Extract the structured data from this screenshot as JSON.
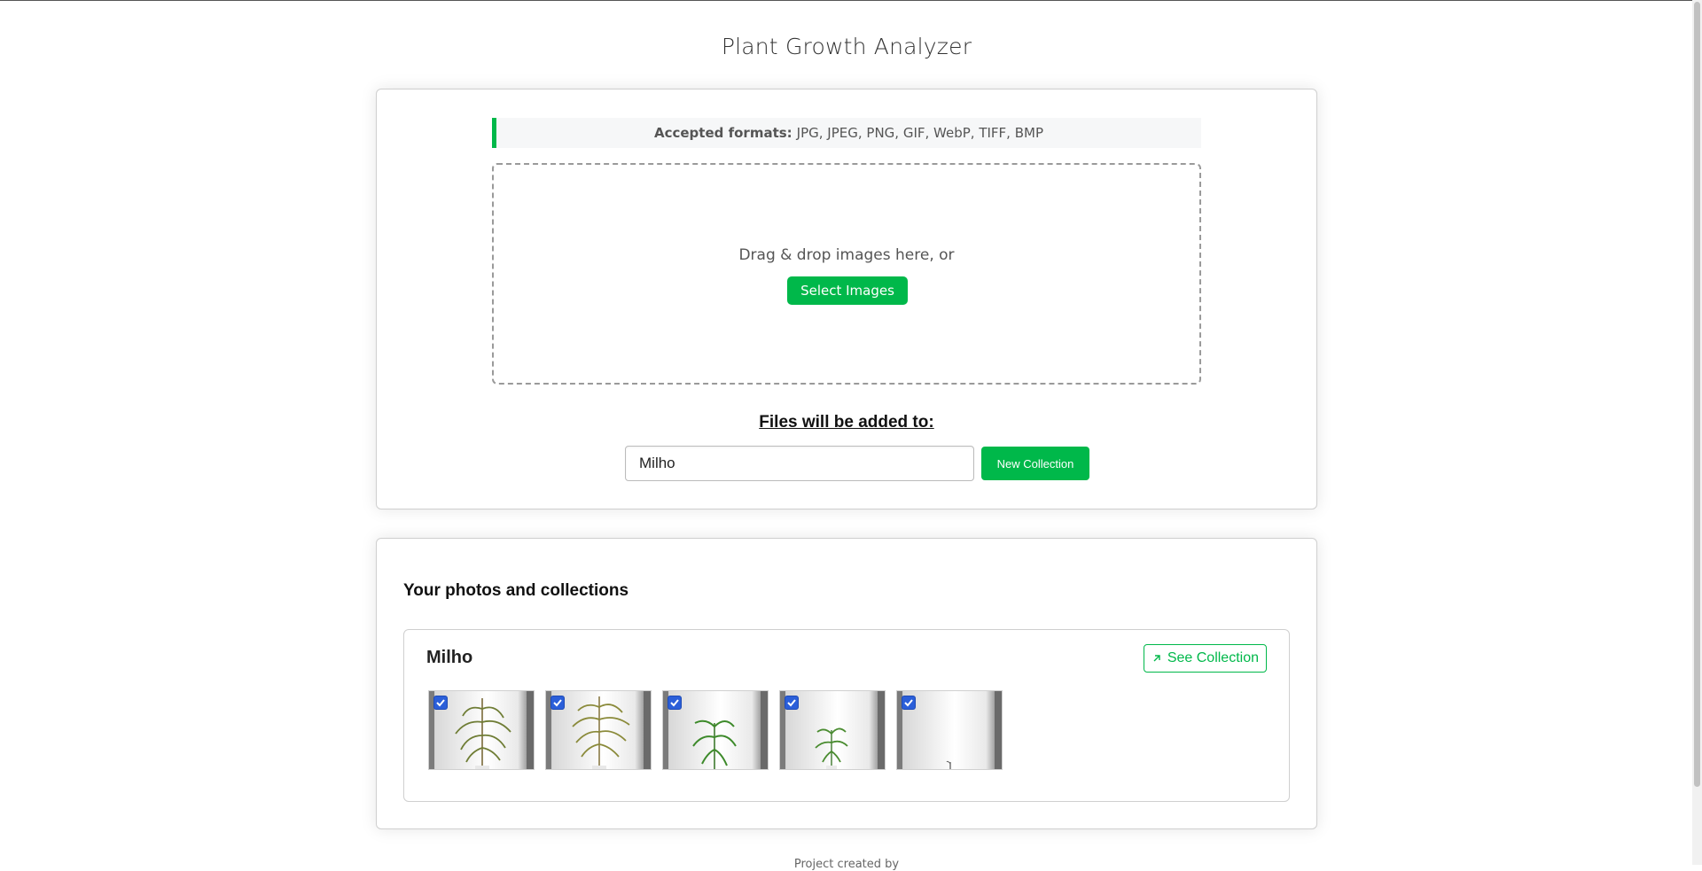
{
  "app": {
    "title": "Plant Growth Analyzer"
  },
  "upload": {
    "formats_label": "Accepted formats:",
    "formats_value": "JPG, JPEG, PNG, GIF, WebP, TIFF, BMP",
    "drop_text": "Drag & drop images here, or",
    "select_button": "Select Images",
    "added_to_label": "Files will be added to:",
    "collection_value": "Milho",
    "new_collection_button": "New Collection"
  },
  "photos": {
    "section_title": "Your photos and collections",
    "collections": [
      {
        "name": "Milho",
        "see_button": "See Collection",
        "images": [
          {
            "checked": true,
            "plant": "tall-mature"
          },
          {
            "checked": true,
            "plant": "tall-mature"
          },
          {
            "checked": true,
            "plant": "medium-young"
          },
          {
            "checked": true,
            "plant": "small-young"
          },
          {
            "checked": true,
            "plant": "seedling"
          }
        ]
      }
    ]
  },
  "footer": {
    "text": "Project created by"
  },
  "colors": {
    "accent": "#00b84a",
    "checkbox": "#2b5fd9"
  }
}
